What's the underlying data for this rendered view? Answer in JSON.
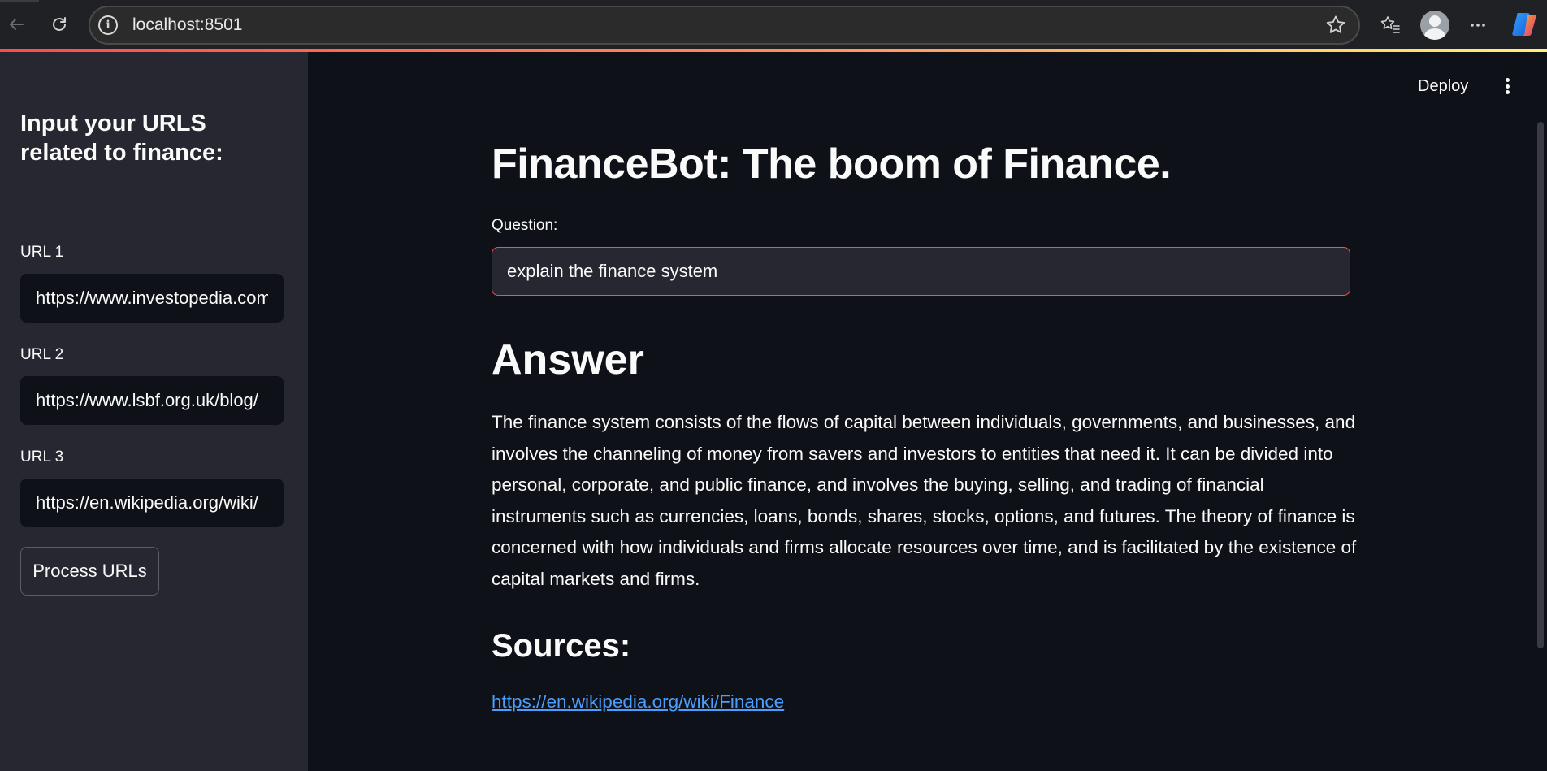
{
  "browser": {
    "address": "localhost:8501",
    "icons": [
      "back-arrow-icon",
      "reload-icon",
      "info-icon",
      "star-icon",
      "favorites-icon",
      "profile-avatar",
      "more-icon",
      "copilot-icon"
    ]
  },
  "app": {
    "deploy_label": "Deploy",
    "accent_color": "#ff4b4b",
    "background_color": "#0e1117",
    "sidebar_color": "#262730",
    "link_color": "#4a9eff"
  },
  "sidebar": {
    "heading": "Input your URLS related to finance:",
    "urls": [
      {
        "label": "URL 1",
        "value": "https://www.investopedia.com"
      },
      {
        "label": "URL 2",
        "value": "https://www.lsbf.org.uk/blog/"
      },
      {
        "label": "URL 3",
        "value": "https://en.wikipedia.org/wiki/"
      }
    ],
    "process_button": "Process URLs"
  },
  "main": {
    "title": "FinanceBot: The boom of Finance.",
    "question_label": "Question:",
    "question_value": "explain the finance system",
    "answer_heading": "Answer",
    "answer_text": "The finance system consists of the flows of capital between individuals, governments, and businesses, and involves the channeling of money from savers and investors to entities that need it. It can be divided into personal, corporate, and public finance, and involves the buying, selling, and trading of financial instruments such as currencies, loans, bonds, shares, stocks, options, and futures. The theory of finance is concerned with how individuals and firms allocate resources over time, and is facilitated by the existence of capital markets and firms.",
    "sources_heading": "Sources:",
    "source_link": "https://en.wikipedia.org/wiki/Finance"
  }
}
